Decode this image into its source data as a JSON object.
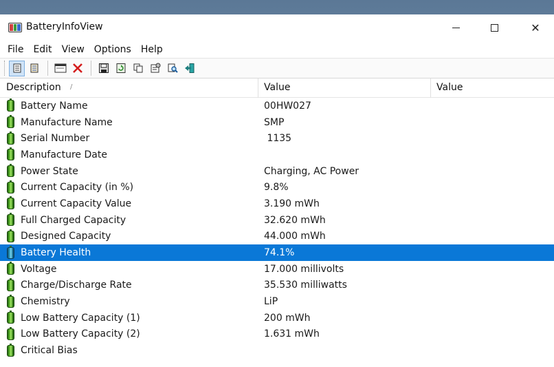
{
  "window": {
    "title": "BatteryInfoView"
  },
  "menu": [
    "File",
    "Edit",
    "View",
    "Options",
    "Help"
  ],
  "toolbar": {
    "icons": [
      "properties-icon",
      "html-report-icon",
      "window-icon",
      "delete-icon",
      "save-icon",
      "refresh-icon",
      "copy-icon",
      "options-icon",
      "find-icon",
      "exit-icon"
    ]
  },
  "columns": [
    "Description",
    "Value",
    "Value"
  ],
  "rows": [
    {
      "desc": "Battery Name",
      "value": "00HW027"
    },
    {
      "desc": "Manufacture Name",
      "value": "SMP"
    },
    {
      "desc": "Serial Number",
      "value": " 1135"
    },
    {
      "desc": "Manufacture Date",
      "value": ""
    },
    {
      "desc": "Power State",
      "value": "Charging, AC Power"
    },
    {
      "desc": "Current Capacity (in %)",
      "value": "9.8%"
    },
    {
      "desc": "Current Capacity Value",
      "value": "3.190 mWh"
    },
    {
      "desc": "Full Charged Capacity",
      "value": "32.620 mWh"
    },
    {
      "desc": "Designed Capacity",
      "value": "44.000 mWh"
    },
    {
      "desc": "Battery Health",
      "value": "74.1%",
      "selected": true
    },
    {
      "desc": "Voltage",
      "value": "17.000 millivolts"
    },
    {
      "desc": "Charge/Discharge Rate",
      "value": "35.530 milliwatts"
    },
    {
      "desc": "Chemistry",
      "value": "LiP"
    },
    {
      "desc": "Low Battery Capacity (1)",
      "value": "200 mWh"
    },
    {
      "desc": "Low Battery Capacity (2)",
      "value": "1.631 mWh"
    },
    {
      "desc": "Critical Bias",
      "value": ""
    }
  ]
}
